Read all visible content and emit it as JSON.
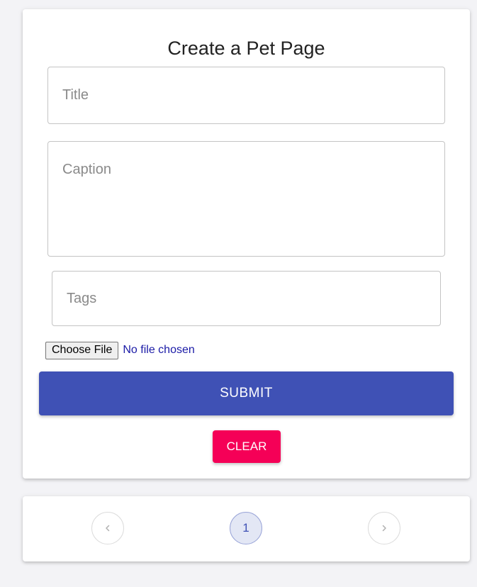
{
  "form": {
    "title": "Create a Pet Page",
    "title_field": {
      "placeholder": "Title",
      "value": ""
    },
    "caption_field": {
      "placeholder": "Caption",
      "value": ""
    },
    "tags_field": {
      "placeholder": "Tags",
      "value": ""
    },
    "file_input": {
      "button_label": "Choose File",
      "status": "No file chosen"
    },
    "submit_label": "SUBMIT",
    "clear_label": "CLEAR"
  },
  "pagination": {
    "prev_icon": "chevron-left-icon",
    "current_page": "1",
    "next_icon": "chevron-right-icon"
  },
  "colors": {
    "primary": "#3f51b5",
    "secondary": "#f50057",
    "background": "#f3f3f6",
    "card": "#ffffff"
  }
}
